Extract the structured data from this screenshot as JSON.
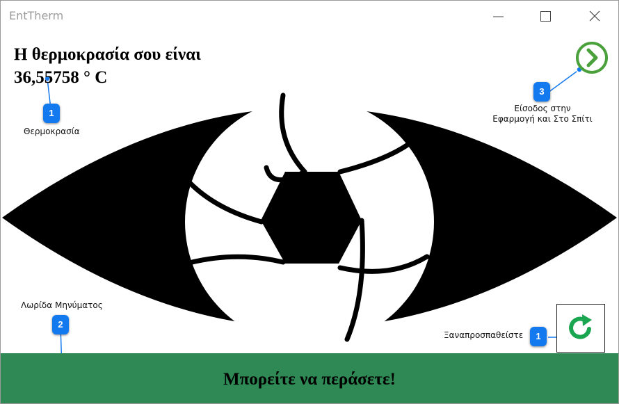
{
  "window": {
    "title": "EntTherm",
    "controls": [
      "minimize",
      "maximize",
      "close"
    ]
  },
  "temperature": {
    "heading": "Η θερμοκρασία σου είναι",
    "value": "36,55758 ° C"
  },
  "annotations": [
    {
      "number": "1",
      "label": "Θερμοκρασία"
    },
    {
      "number": "2",
      "label": "Λωρίδα Μηνύματος"
    },
    {
      "number": "3",
      "label_line1": "Είσοδος στην",
      "label_line2": "Εφαρμογή και Στο Σπίτι"
    },
    {
      "number": "1",
      "label": "Ξαναπροσπαθείστε"
    }
  ],
  "message_strip": {
    "text": "Μπορείτε να περάσετε!",
    "color": "#2e8955"
  },
  "icons": {
    "next": "chevron-right-circle-icon",
    "retry": "refresh-icon",
    "eye": "eye-shutter-logo"
  },
  "colors": {
    "accent_green": "#4aa03a",
    "retry_green": "#1aa650",
    "badge_blue": "#1279ee",
    "title_gray": "#9b9b9b"
  }
}
